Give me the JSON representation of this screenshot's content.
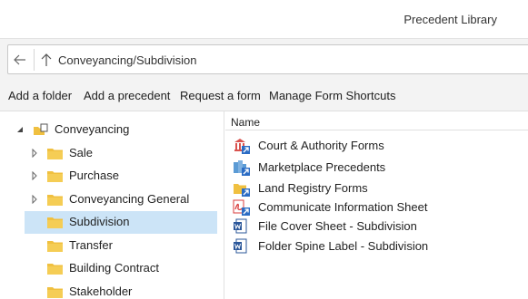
{
  "window": {
    "title": "Precedent Library"
  },
  "pathbar": {
    "back_icon": "back-arrow-icon",
    "up_icon": "up-arrow-icon",
    "path": "Conveyancing/Subdivision"
  },
  "toolbar": {
    "add_folder": "Add a folder",
    "add_precedent": "Add a precedent",
    "request_form": "Request a form",
    "manage_shortcuts": "Manage Form Shortcuts"
  },
  "tree": {
    "root": {
      "label": "Conveyancing",
      "expanded": true,
      "icon": "folder-link-icon"
    },
    "items": [
      {
        "label": "Sale",
        "expandable": true,
        "selected": false
      },
      {
        "label": "Purchase",
        "expandable": true,
        "selected": false
      },
      {
        "label": "Conveyancing General",
        "expandable": true,
        "selected": false
      },
      {
        "label": "Subdivision",
        "expandable": false,
        "selected": true
      },
      {
        "label": "Transfer",
        "expandable": false,
        "selected": false
      },
      {
        "label": "Building Contract",
        "expandable": false,
        "selected": false
      },
      {
        "label": "Stakeholder",
        "expandable": false,
        "selected": false
      }
    ]
  },
  "list": {
    "column_name": "Name",
    "items": [
      {
        "label": "Court & Authority Forms",
        "icon": "courthouse-shortcut-icon"
      },
      {
        "label": "Marketplace Precedents",
        "icon": "buildings-shortcut-icon"
      },
      {
        "label": "Land Registry Forms",
        "icon": "folder-shortcut-icon"
      },
      {
        "label": "Communicate Information Sheet",
        "icon": "pdf-shortcut-icon"
      },
      {
        "label": "File Cover Sheet - Subdivision",
        "icon": "word-document-icon"
      },
      {
        "label": "Folder Spine Label - Subdivision",
        "icon": "word-document-icon"
      }
    ]
  },
  "colors": {
    "selection": "#cce4f7",
    "folder": "#f0c040",
    "accent": "#2b6cc4",
    "pdf": "#d83b3b"
  }
}
